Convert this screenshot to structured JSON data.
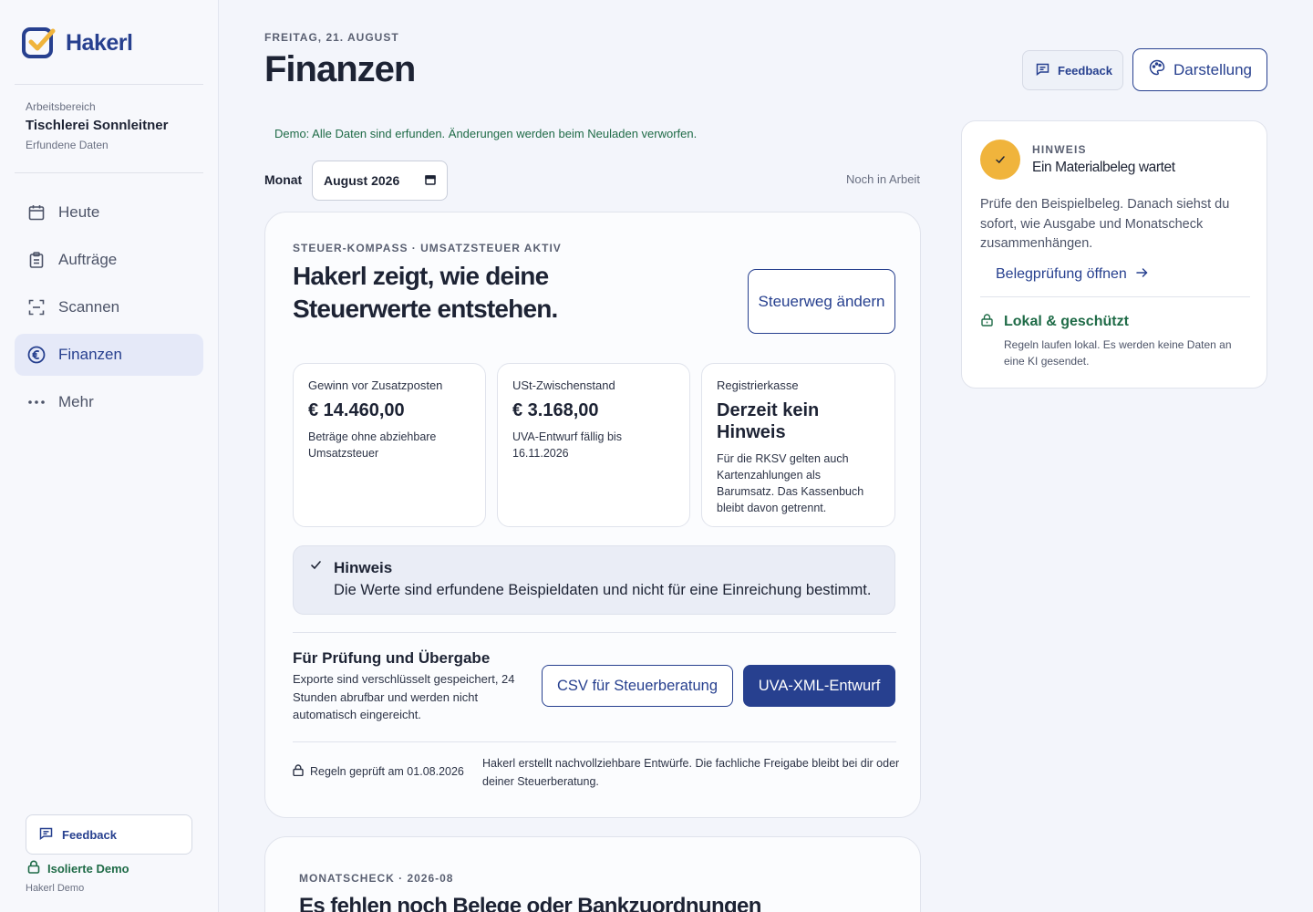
{
  "brand": {
    "name": "Hakerl",
    "accent": "#27408f",
    "check_color": "#f0b43c"
  },
  "workspace": {
    "label": "Arbeitsbereich",
    "name": "Tischlerei Sonnleitner",
    "sub": "Erfundene Daten"
  },
  "nav": {
    "items": [
      {
        "label": "Heute",
        "icon": "calendar-icon"
      },
      {
        "label": "Aufträge",
        "icon": "clipboard-icon"
      },
      {
        "label": "Scannen",
        "icon": "scan-icon"
      },
      {
        "label": "Finanzen",
        "icon": "euro-icon",
        "active": true
      },
      {
        "label": "Mehr",
        "icon": "more-dots-icon"
      }
    ]
  },
  "sidebar_footer": {
    "feedback_label": "Feedback",
    "isolated_label": "Isolierte Demo",
    "sub": "Hakerl Demo"
  },
  "header": {
    "date": "FREITAG, 21. AUGUST",
    "title": "Finanzen",
    "feedback_label": "Feedback",
    "appearance_label": "Darstellung"
  },
  "demo_note": "Demo: Alle Daten sind erfunden. Änderungen werden beim Neuladen verworfen.",
  "month": {
    "label": "Monat",
    "value": "August 2026",
    "status": "Noch in Arbeit"
  },
  "tax_card": {
    "kicker": "STEUER-KOMPASS · UMSATZSTEUER AKTIV",
    "headline": "Hakerl zeigt, wie deine Steuerwerte entstehen.",
    "change_button": "Steuerweg ändern",
    "stats": [
      {
        "label": "Gewinn vor Zusatzposten",
        "value": "€ 14.460,00",
        "desc": "Beträge ohne abziehbare Umsatzsteuer"
      },
      {
        "label": "USt-Zwischenstand",
        "value": "€ 3.168,00",
        "desc": "UVA-Entwurf fällig bis 16.11.2026"
      },
      {
        "label": "Registrierkasse",
        "value": "Derzeit kein Hinweis",
        "desc": "Für die RKSV gelten auch Kartenzahlungen als Barumsatz. Das Kassenbuch bleibt davon getrennt."
      }
    ],
    "notice": {
      "title": "Hinweis",
      "text": "Die Werte sind erfundene Beispieldaten und nicht für eine Einreichung bestimmt."
    },
    "handover": {
      "title": "Für Prüfung und Übergabe",
      "text": "Exporte sind verschlüsselt gespeichert, 24 Stunden abrufbar und werden nicht automatisch eingereicht.",
      "csv_button": "CSV für Steuerberatung",
      "uva_button": "UVA-XML-Entwurf"
    },
    "rules_checked": "Regeln geprüft am 01.08.2026",
    "rules_note": "Hakerl erstellt nachvollziehbare Entwürfe. Die fachliche Freigabe bleibt bei dir oder deiner Steuerberatung."
  },
  "month_check": {
    "kicker": "MONATSCHECK · 2026-08",
    "title": "Es fehlen noch Belege oder Bankzuordnungen"
  },
  "hint_card": {
    "kicker": "HINWEIS",
    "title": "Ein Materialbeleg wartet",
    "text": "Prüfe den Beispielbeleg. Danach siehst du sofort, wie Ausgabe und Monatscheck zusammenhängen.",
    "link": "Belegprüfung öffnen",
    "secure_title": "Lokal & geschützt",
    "secure_text": "Regeln laufen lokal. Es werden keine Daten an eine KI gesendet."
  }
}
